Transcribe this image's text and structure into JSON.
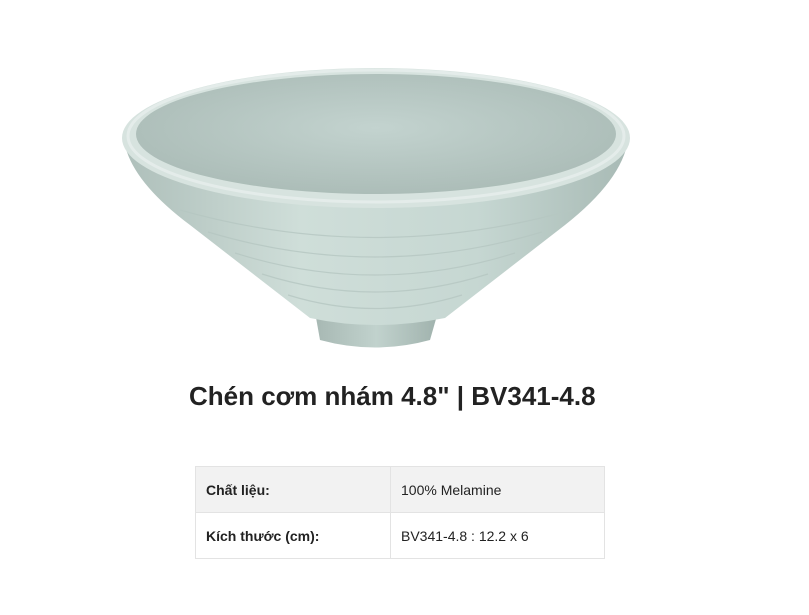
{
  "product": {
    "image_name": "bowl-product-photo",
    "title": "Chén cơm nhám 4.8\" | BV341-4.8"
  },
  "specs": [
    {
      "label": "Chất liệu:",
      "value": "100% Melamine"
    },
    {
      "label": "Kích thước (cm):",
      "value": "BV341-4.8 : 12.2 x 6"
    }
  ],
  "colors": {
    "bowl": "#c5d6d1",
    "table_header_bg": "#f2f2f2",
    "text": "#222222"
  }
}
